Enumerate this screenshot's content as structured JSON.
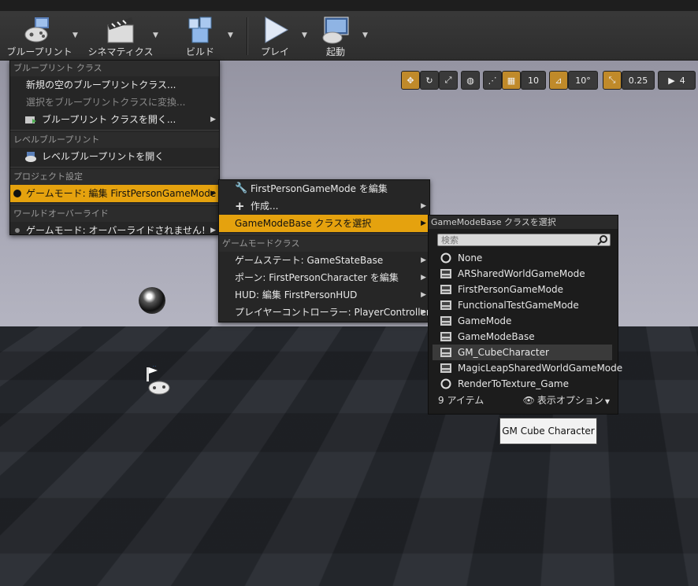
{
  "toolbar": {
    "buttons": [
      {
        "label": "ブループリント",
        "icon": "gamepad-icon"
      },
      {
        "label": "シネマティクス",
        "icon": "clapperboard-icon"
      },
      {
        "label": "ビルド",
        "icon": "build-blocks-icon"
      },
      {
        "label": "プレイ",
        "icon": "play-icon"
      },
      {
        "label": "起動",
        "icon": "launch-monitor-icon"
      }
    ]
  },
  "viewport_controls": {
    "grid_snap": "10",
    "rotation_snap": "10°",
    "scale_snap": "0.25",
    "camera_speed": "4"
  },
  "blueprint_menu": {
    "section_blueprint_class": "ブループリント クラス",
    "new_empty_class": "新規の空のブループリントクラス...",
    "convert_selection": "選択をブループリントクラスに変換...",
    "open_class": "ブループリント クラスを開く...",
    "section_level_blueprint": "レベルブループリント",
    "open_level_blueprint": "レベルブループリントを開く",
    "section_project_settings": "プロジェクト設定",
    "game_mode_edit": "ゲームモード: 編集 FirstPersonGameMode",
    "section_world_override": "ワールドオーバーライド",
    "game_mode_override": "ゲームモード: オーバーライドされません!"
  },
  "gamemode_menu": {
    "edit_item": "FirstPersonGameMode を編集",
    "create_item": "作成...",
    "select_base": "GameModeBase クラスを選択",
    "section_classes": "ゲームモードクラス",
    "game_state": "ゲームステート: GameStateBase",
    "pawn": "ポーン: FirstPersonCharacter を編集",
    "hud": "HUD: 編集 FirstPersonHUD",
    "player_controller": "プレイヤーコントローラー: PlayerController"
  },
  "class_picker": {
    "title": "GameModeBase クラスを選択",
    "search_placeholder": "検索",
    "items": [
      {
        "label": "None",
        "icon": "none-circle-icon"
      },
      {
        "label": "ARSharedWorldGameMode",
        "icon": "class-icon"
      },
      {
        "label": "FirstPersonGameMode",
        "icon": "class-icon"
      },
      {
        "label": "FunctionalTestGameMode",
        "icon": "class-icon"
      },
      {
        "label": "GameMode",
        "icon": "class-icon"
      },
      {
        "label": "GameModeBase",
        "icon": "class-icon"
      },
      {
        "label": "GM_CubeCharacter",
        "icon": "class-icon",
        "selected": true
      },
      {
        "label": "MagicLeapSharedWorldGameMode",
        "icon": "class-icon"
      },
      {
        "label": "RenderToTexture_Game",
        "icon": "none-circle-icon"
      }
    ],
    "item_count": "9 アイテム",
    "view_options": "表示オプション"
  },
  "tooltip": {
    "text": "GM Cube Character"
  },
  "colors": {
    "highlight": "#e5a20e",
    "menu_bg": "#262626",
    "toolbar_bg": "#333333"
  }
}
